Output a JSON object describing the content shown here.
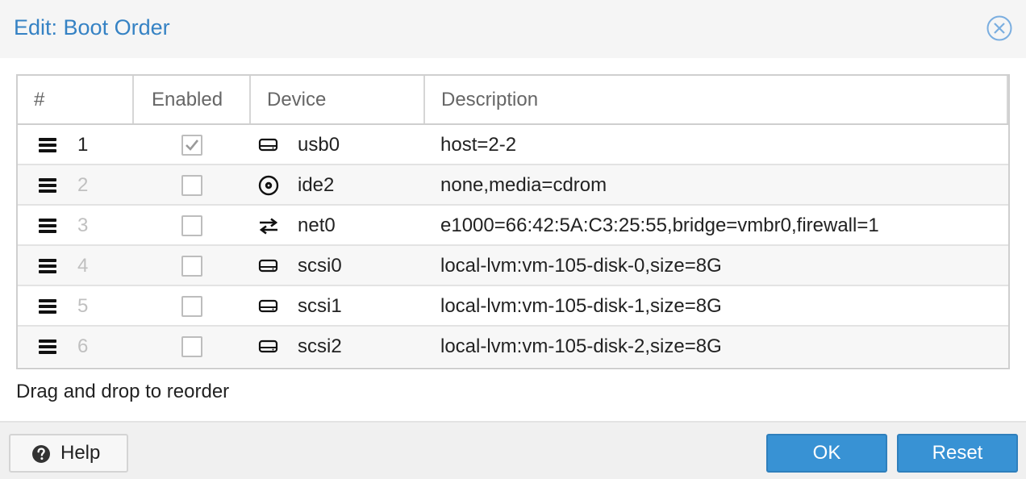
{
  "dialog": {
    "title": "Edit: Boot Order",
    "close_icon": "close-circle-icon"
  },
  "grid": {
    "columns": [
      "#",
      "Enabled",
      "Device",
      "Description"
    ],
    "rows": [
      {
        "order": "1",
        "enabled": true,
        "device": "usb0",
        "device_icon": "hdd-icon",
        "description": "host=2-2"
      },
      {
        "order": "2",
        "enabled": false,
        "device": "ide2",
        "device_icon": "cdrom-icon",
        "description": "none,media=cdrom"
      },
      {
        "order": "3",
        "enabled": false,
        "device": "net0",
        "device_icon": "network-exchange-icon",
        "description": "e1000=66:42:5A:C3:25:55,bridge=vmbr0,firewall=1"
      },
      {
        "order": "4",
        "enabled": false,
        "device": "scsi0",
        "device_icon": "hdd-icon",
        "description": "local-lvm:vm-105-disk-0,size=8G"
      },
      {
        "order": "5",
        "enabled": false,
        "device": "scsi1",
        "device_icon": "hdd-icon",
        "description": "local-lvm:vm-105-disk-1,size=8G"
      },
      {
        "order": "6",
        "enabled": false,
        "device": "scsi2",
        "device_icon": "hdd-icon",
        "description": "local-lvm:vm-105-disk-2,size=8G"
      }
    ]
  },
  "hint": "Drag and drop to reorder",
  "footer": {
    "help_label": "Help",
    "help_icon": "question-circle-icon",
    "ok_label": "OK",
    "reset_label": "Reset"
  },
  "colors": {
    "accent": "#3892d4",
    "title": "#3582c4",
    "disabled_text": "#c0c0c0"
  }
}
